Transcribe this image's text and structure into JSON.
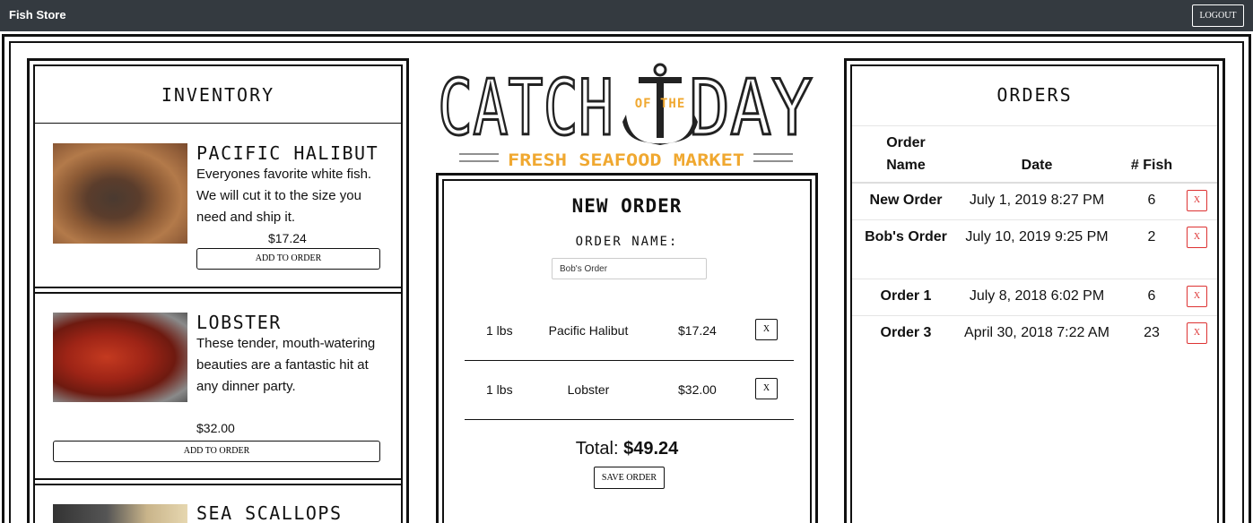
{
  "navbar": {
    "brand": "Fish Store",
    "logout_label": "LOGOUT"
  },
  "colors": {
    "navbar_bg": "#343a40",
    "logo_accent": "#f0a830",
    "delete_red": "#d33333"
  },
  "inventory": {
    "title": "Inventory",
    "add_label": "ADD TO ORDER",
    "items": [
      {
        "name": "Pacific Halibut",
        "description": "Everyones favorite white fish. We will cut it to the size you need and ship it.",
        "price": "$17.24"
      },
      {
        "name": "Lobster",
        "description": "These tender, mouth-watering beauties are a fantastic hit at any dinner party.",
        "price": "$32.00"
      },
      {
        "name": "Sea Scallops"
      }
    ]
  },
  "logo": {
    "catch": "CATCH",
    "of_the": "OF THE",
    "day": "DAY",
    "tagline": "FRESH SEAFOOD MARKET",
    "icon": "anchor-icon"
  },
  "new_order": {
    "title": "New Order",
    "name_label": "Order Name:",
    "name_value": "Bob's Order",
    "items": [
      {
        "qty": "1 lbs",
        "name": "Pacific Halibut",
        "price": "$17.24",
        "remove": "X"
      },
      {
        "qty": "1 lbs",
        "name": "Lobster",
        "price": "$32.00",
        "remove": "X"
      }
    ],
    "total_label": "Total:",
    "total_value": "$49.24",
    "save_label": "SAVE ORDER"
  },
  "orders": {
    "title": "Orders",
    "headers": {
      "name_line1": "Order",
      "name_line2": "Name",
      "date": "Date",
      "fish": "# Fish"
    },
    "rows": [
      {
        "name": "New Order",
        "date": "July 1, 2019 8:27 PM",
        "fish": "6",
        "remove": "X"
      },
      {
        "name": "Bob's Order",
        "date": "July 10, 2019 9:25 PM",
        "fish": "2",
        "remove": "X"
      },
      {
        "name": "Order 1",
        "date": "July 8, 2018 6:02 PM",
        "fish": "6",
        "remove": "X"
      },
      {
        "name": "Order 3",
        "date": "April 30, 2018 7:22 AM",
        "fish": "23",
        "remove": "X"
      }
    ]
  }
}
